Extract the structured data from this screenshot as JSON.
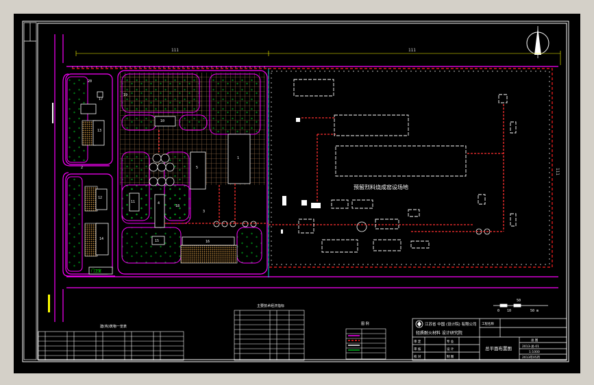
{
  "drawing": {
    "background_color": "#000000",
    "frame_color": "#d4d0c8",
    "colors": {
      "border": "#ffffff",
      "road": "#ff00ff",
      "fence": "#ff2a2a",
      "fence_alt": "#ffffff",
      "grid": "#d8a060",
      "tree": "#00c020",
      "hatch": "#c8a040",
      "text": "#ffffff",
      "dim": "#e0e0e0",
      "yellow": "#ffff00",
      "cyan": "#00ffff"
    }
  },
  "dimensions": {
    "top_left": "111",
    "top_right": "111",
    "right_side": "111"
  },
  "zone_label": "预留烈料烧成窑设场地",
  "buildings": {
    "b1": "1",
    "b2": "2",
    "b3": "3",
    "b4": "4",
    "b5": "5",
    "b10": "10",
    "b11": "11",
    "b12": "12",
    "b13": "13",
    "b14": "14",
    "b15": "15",
    "b16": "16",
    "b17": "17",
    "b18": "18",
    "b19": "19",
    "b20": "20"
  },
  "gate_label": "门卫室",
  "scale_bar": {
    "label": "50",
    "ticks": [
      "0",
      "10",
      "50 m"
    ]
  },
  "legend_title": "图    例",
  "building_table_title": "建(构)筑物一览表",
  "tech_table_title": "主要技术经济指标",
  "title_block": {
    "company": "江苏省 中国  (设计院) 有限公司",
    "company2": "轻质耐火材料 设计研究院",
    "project": "工程名称",
    "drawing_title": "总平面布置图",
    "rows": [
      "审 定",
      "审 核",
      "校 对"
    ],
    "rows2": [
      "专 业",
      "设 计",
      "制 图"
    ],
    "right_cells": [
      "总 图",
      "2013-总-01",
      "1:1000",
      "2013年05月"
    ]
  }
}
